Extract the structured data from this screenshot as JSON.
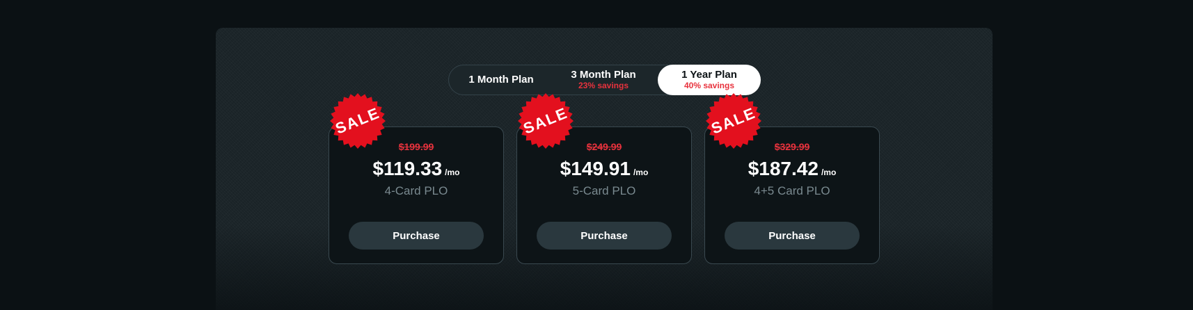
{
  "plan_toggle": {
    "options": [
      {
        "label": "1 Month Plan",
        "savings": ""
      },
      {
        "label": "3 Month Plan",
        "savings": "23% savings"
      },
      {
        "label": "1 Year Plan",
        "savings": "40% savings"
      }
    ],
    "selected": "1 Year Plan"
  },
  "badge_text": "SALE",
  "colors": {
    "accent_red": "#e8323d",
    "background": "#0b1114",
    "button": "#2a383e",
    "selected_toggle": "#ffffff"
  },
  "plans": [
    {
      "old_price": "$199.99",
      "price": "$119.33",
      "per": "/mo",
      "game": "4-Card PLO",
      "button": "Purchase"
    },
    {
      "old_price": "$249.99",
      "price": "$149.91",
      "per": "/mo",
      "game": "5-Card PLO",
      "button": "Purchase"
    },
    {
      "old_price": "$329.99",
      "price": "$187.42",
      "per": "/mo",
      "game": "4+5 Card PLO",
      "button": "Purchase"
    }
  ]
}
